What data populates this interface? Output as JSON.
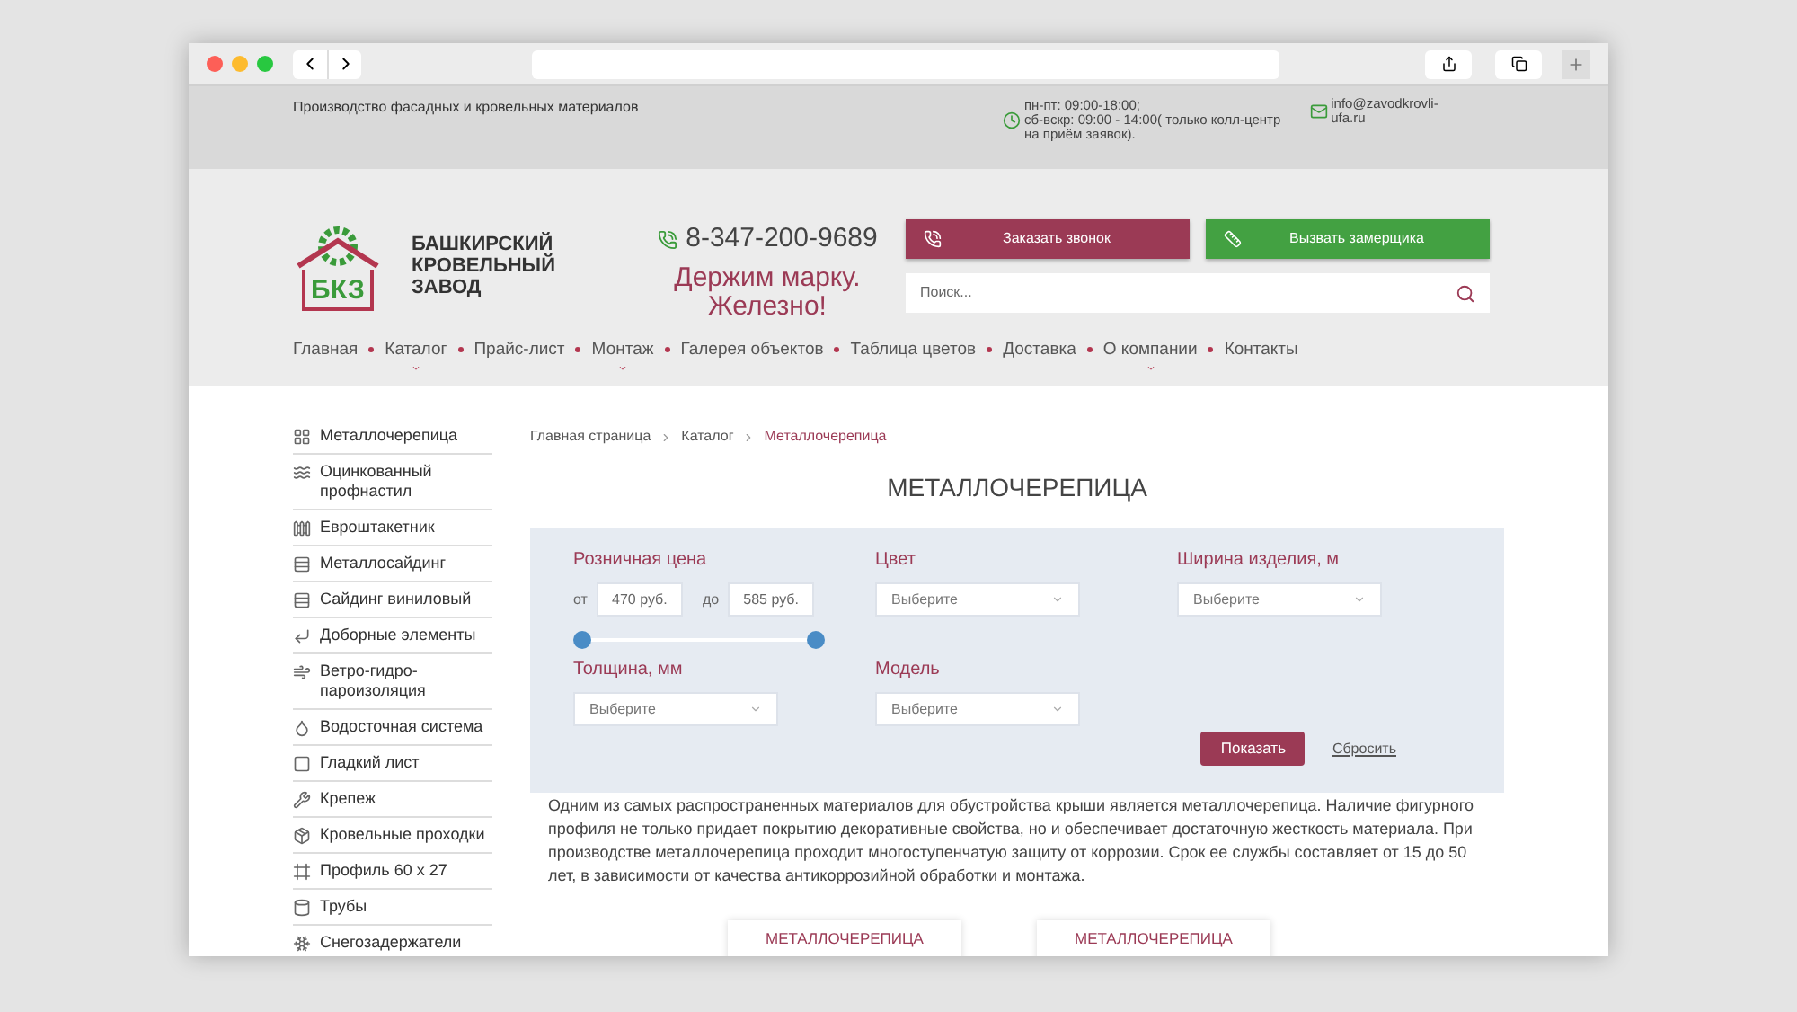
{
  "topbar": {
    "tagline": "Производство фасадных и кровельных материалов",
    "hours": "пн-пт: 09:00-18:00;\nсб-вскр: 09:00 - 14:00( только колл-центр\nна приём заявок).",
    "email": "info@zavodkrovli-\nufa.ru"
  },
  "header": {
    "logo_mark": "БКЗ",
    "logo_text": "БАШКИРСКИЙ\nКРОВЕЛЬНЫЙ\nЗАВОД",
    "phone": "8-347-200-9689",
    "slogan": "Держим марку.\nЖелезно!",
    "buttons": [
      {
        "label": "Заказать звонок",
        "kind": "call"
      },
      {
        "label": "Вызвать замерщика",
        "kind": "measure"
      }
    ],
    "search": {
      "placeholder": "Поиск..."
    }
  },
  "nav": [
    {
      "label": "Главная",
      "has_dropdown": false
    },
    {
      "label": "Каталог",
      "has_dropdown": true
    },
    {
      "label": "Прайс-лист",
      "has_dropdown": false
    },
    {
      "label": "Монтаж",
      "has_dropdown": true
    },
    {
      "label": "Галерея объектов",
      "has_dropdown": false
    },
    {
      "label": "Таблица цветов",
      "has_dropdown": false
    },
    {
      "label": "Доставка",
      "has_dropdown": false
    },
    {
      "label": "О компании",
      "has_dropdown": true
    },
    {
      "label": "Контакты",
      "has_dropdown": false
    }
  ],
  "sidebar": {
    "items": [
      {
        "label": "Металлочерепица",
        "kind": "tile"
      },
      {
        "label": "Оцинкованный\nпрофнастил",
        "kind": "wave"
      },
      {
        "label": "Евроштакетник",
        "kind": "fence"
      },
      {
        "label": "Металлосайдинг",
        "kind": "siding"
      },
      {
        "label": "Сайдинг виниловый",
        "kind": "siding"
      },
      {
        "label": "Доборные элементы",
        "kind": "corner"
      },
      {
        "label": "Ветро-гидро-\nпароизоляция",
        "kind": "roll"
      },
      {
        "label": "Водосточная система",
        "kind": "pipe"
      },
      {
        "label": "Гладкий лист",
        "kind": "sheet"
      },
      {
        "label": "Крепеж",
        "kind": "screw"
      },
      {
        "label": "Кровельные проходки",
        "kind": "pass"
      },
      {
        "label": "Профиль 60 х 27",
        "kind": "profile"
      },
      {
        "label": "Трубы",
        "kind": "tube"
      },
      {
        "label": "Снегозадержатели",
        "kind": "snow"
      }
    ]
  },
  "breadcrumbs": [
    {
      "label": "Главная страница",
      "current": false
    },
    {
      "label": "Каталог",
      "current": false
    },
    {
      "label": "Металлочерепица",
      "current": true
    }
  ],
  "title": "МЕТАЛЛОЧЕРЕПИЦА",
  "filter": {
    "price": {
      "label": "Розничная цена",
      "from_label": "от",
      "from_value": "470 руб.",
      "to_label": "до",
      "to_value": "585 руб.",
      "handles": [
        {
          "level": 0
        },
        {
          "level": 1
        }
      ]
    },
    "selects": [
      {
        "label": "Цвет",
        "placeholder": "Выберите"
      },
      {
        "label": "Ширина изделия, м",
        "placeholder": "Выберите"
      },
      {
        "label": "Толщина, мм",
        "placeholder": "Выберите"
      },
      {
        "label": "Модель",
        "placeholder": "Выберите"
      }
    ],
    "submit": "Показать",
    "reset": "Сбросить"
  },
  "description": "Одним из самых распространенных материалов для обустройства крыши является металлочерепица. Наличие фигурного профиля не только придает покрытию декоративные свойства, но и обеспечивает достаточную жесткость материала. При производстве металлочерепица проходит многоступенчатую защиту от коррозии. Срок ее службы составляет от 15 до 50 лет, в зависимости от качества антикоррозийной обработки и монтажа.",
  "cards": [
    {
      "label": "МЕТАЛЛОЧЕРЕПИЦА"
    },
    {
      "label": "МЕТАЛЛОЧЕРЕПИЦА"
    }
  ]
}
